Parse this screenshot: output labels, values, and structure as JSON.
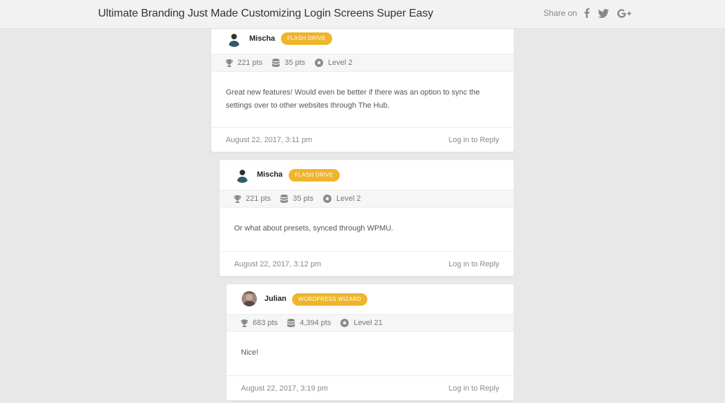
{
  "header": {
    "title": "Ultimate Branding Just Made Customizing Login Screens Super Easy",
    "share_label": "Share on",
    "share_icons": [
      "facebook-icon",
      "twitter-icon",
      "google-plus-icon"
    ]
  },
  "colors": {
    "badge": "#f0b429",
    "background": "#e8e8e8"
  },
  "comments": [
    {
      "author": "Mischa",
      "badge": "FLASH DRIVE",
      "points": "221 pts",
      "stash": "35 pts",
      "level": "Level 2",
      "text": "Great new features! Would even be better if there was an option to sync the settings over to other websites through The Hub.",
      "date": "August 22, 2017, 3:11 pm",
      "reply": "Log in to Reply"
    },
    {
      "author": "Mischa",
      "badge": "FLASH DRIVE",
      "points": "221 pts",
      "stash": "35 pts",
      "level": "Level 2",
      "text": "Or what about presets, synced through WPMU.",
      "date": "August 22, 2017, 3:12 pm",
      "reply": "Log in to Reply"
    },
    {
      "author": "Julian",
      "badge": "WORDPRESS WIZARD",
      "points": "683 pts",
      "stash": "4,394 pts",
      "level": "Level 21",
      "text": "Nice!",
      "date": "August 22, 2017, 3:19 pm",
      "reply": "Log in to Reply"
    }
  ]
}
